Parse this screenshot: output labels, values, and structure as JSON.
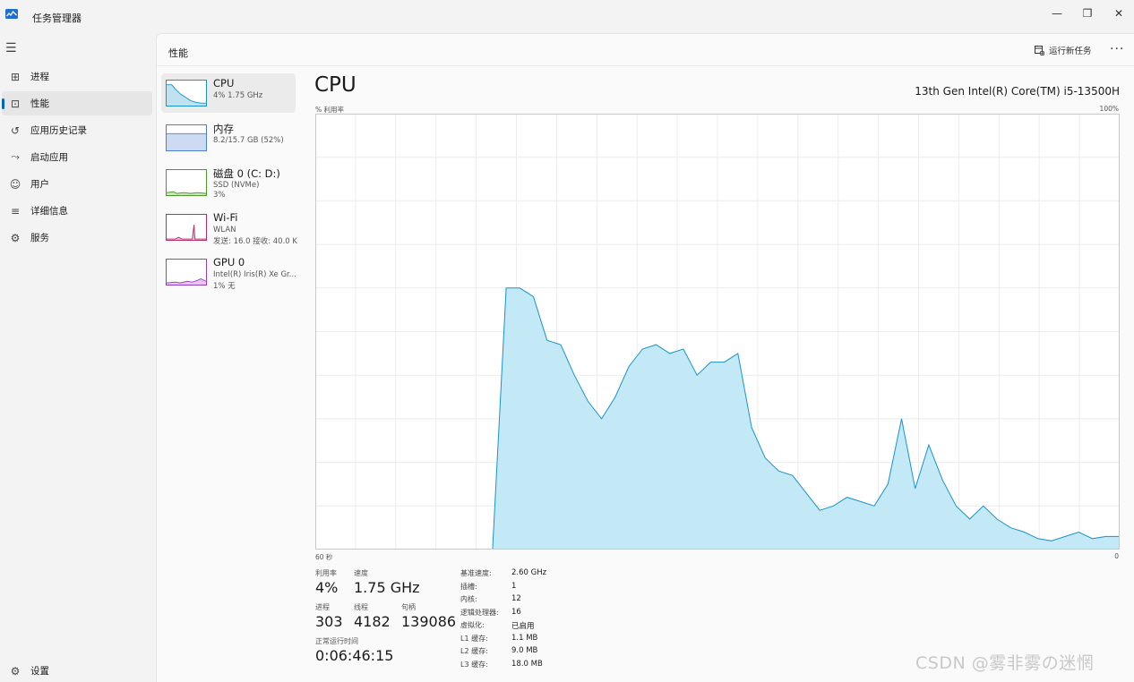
{
  "window": {
    "title": "任务管理器",
    "minimize": "—",
    "restore": "❐",
    "close": "✕"
  },
  "nav": {
    "menu_icon": "hamburger-icon",
    "items": [
      {
        "label": "进程",
        "icon": "processes-icon"
      },
      {
        "label": "性能",
        "icon": "performance-icon",
        "active": true
      },
      {
        "label": "应用历史记录",
        "icon": "history-icon"
      },
      {
        "label": "启动应用",
        "icon": "startup-icon"
      },
      {
        "label": "用户",
        "icon": "users-icon"
      },
      {
        "label": "详细信息",
        "icon": "details-icon"
      },
      {
        "label": "服务",
        "icon": "services-icon"
      }
    ],
    "settings": "设置"
  },
  "header": {
    "title": "性能",
    "run_task": "运行新任务",
    "more": "···"
  },
  "resources": [
    {
      "name": "CPU",
      "sub1": "4%  1.75 GHz",
      "sub2": "",
      "color": "#1a93c9"
    },
    {
      "name": "内存",
      "sub1": "8.2/15.7 GB (52%)",
      "sub2": "",
      "color": "#4d7fd1"
    },
    {
      "name": "磁盘 0 (C: D:)",
      "sub1": "SSD (NVMe)",
      "sub2": "3%",
      "color": "#4b9a27"
    },
    {
      "name": "Wi-Fi",
      "sub1": "WLAN",
      "sub2": "发送: 16.0  接收: 40.0 K",
      "color": "#b52f6e"
    },
    {
      "name": "GPU 0",
      "sub1": "Intel(R) Iris(R) Xe Gr...",
      "sub2": "1%  无",
      "color": "#9a3fbd"
    }
  ],
  "detail": {
    "title": "CPU",
    "model": "13th Gen Intel(R) Core(TM) i5-13500H",
    "y_label": "% 利用率",
    "y_max_label": "100%",
    "x_left_label": "60 秒",
    "x_right_label": "0"
  },
  "chart_data": {
    "type": "area",
    "x_range_seconds": [
      60,
      0
    ],
    "ylim": [
      0,
      100
    ],
    "grid": true,
    "color": "#1a93c9",
    "fill": "#c3e9f7",
    "values": [
      0,
      0,
      0,
      0,
      0,
      0,
      0,
      0,
      0,
      0,
      0,
      0,
      0,
      0,
      60,
      60,
      58,
      48,
      47,
      40,
      34,
      30,
      35,
      42,
      46,
      47,
      45,
      46,
      40,
      43,
      43,
      45,
      28,
      21,
      18,
      17,
      13,
      9,
      10,
      12,
      11,
      10,
      15,
      30,
      14,
      24,
      16,
      10,
      7,
      10,
      7,
      5,
      4,
      2.5,
      2,
      3,
      4,
      2.5,
      3,
      3
    ]
  },
  "stats": {
    "util_label": "利用率",
    "util_value": "4%",
    "speed_label": "速度",
    "speed_value": "1.75 GHz",
    "proc_label": "进程",
    "proc_value": "303",
    "thread_label": "线程",
    "thread_value": "4182",
    "handle_label": "句柄",
    "handle_value": "139086",
    "uptime_label": "正常运行时间",
    "uptime_value": "0:06:46:15"
  },
  "specs": [
    {
      "label": "基准速度:",
      "value": "2.60 GHz"
    },
    {
      "label": "插槽:",
      "value": "1"
    },
    {
      "label": "内核:",
      "value": "12"
    },
    {
      "label": "逻辑处理器:",
      "value": "16"
    },
    {
      "label": "虚拟化:",
      "value": "已启用"
    },
    {
      "label": "L1 缓存:",
      "value": "1.1 MB"
    },
    {
      "label": "L2 缓存:",
      "value": "9.0 MB"
    },
    {
      "label": "L3 缓存:",
      "value": "18.0 MB"
    }
  ],
  "watermark": "CSDN @雾非雾の迷惘"
}
